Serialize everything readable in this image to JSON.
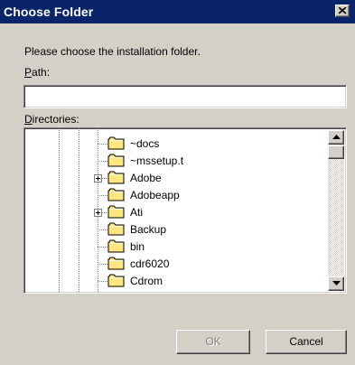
{
  "window": {
    "title": "Choose Folder"
  },
  "close_icon": "close-icon",
  "prompt": "Please choose the installation folder.",
  "path": {
    "label_mnemonic": "P",
    "label_rest": "ath:",
    "value": ""
  },
  "directories": {
    "label_mnemonic": "D",
    "label_rest": "irectories:",
    "items": [
      {
        "label": "~docs",
        "expandable": false
      },
      {
        "label": "~mssetup.t",
        "expandable": false
      },
      {
        "label": "Adobe",
        "expandable": true
      },
      {
        "label": "Adobeapp",
        "expandable": false
      },
      {
        "label": "Ati",
        "expandable": true
      },
      {
        "label": "Backup",
        "expandable": false
      },
      {
        "label": "bin",
        "expandable": false
      },
      {
        "label": "cdr6020",
        "expandable": false
      },
      {
        "label": "Cdrom",
        "expandable": false
      }
    ]
  },
  "buttons": {
    "ok": "OK",
    "cancel": "Cancel"
  },
  "colors": {
    "titlebar": "#0a246a",
    "face": "#d4d0c8",
    "folder": "#ffe680"
  }
}
